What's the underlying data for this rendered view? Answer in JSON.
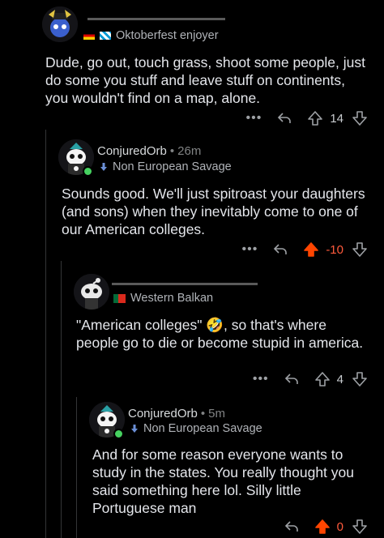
{
  "colors": {
    "background": "#000000",
    "text": "#e4e6eb",
    "muted": "#818384",
    "upvoted_orange": "#ff4500",
    "negative_score": "#ff5a3c",
    "online": "#46d160"
  },
  "comments": [
    {
      "username": "",
      "time": "",
      "flair": "Oktoberfest enjoyer",
      "flair_icons": [
        "germany-flag-icon",
        "bavaria-flag-icon"
      ],
      "body": "Dude, go out, touch grass, shoot some people, just do some you stuff and leave stuff on continents, you wouldn't find on a map, alone.",
      "score": "14",
      "voted": "none"
    },
    {
      "username": "ConjuredOrb",
      "time": "26m",
      "flair": "Non European Savage",
      "flair_icons": [
        "arrow-down-icon"
      ],
      "body": "Sounds good. We'll just spitroast your daughters (and sons) when they inevitably come to one of our American colleges.",
      "score": "-10",
      "voted": "up"
    },
    {
      "username": "",
      "time": "",
      "flair": "Western Balkan",
      "flair_icons": [
        "portugal-flag-icon"
      ],
      "body": "\"American colleges\" 🤣, so that's where people go to die or become stupid in america.",
      "score": "4",
      "voted": "none"
    },
    {
      "username": "ConjuredOrb",
      "time": "5m",
      "flair": "Non European Savage",
      "flair_icons": [
        "arrow-down-icon"
      ],
      "body": "And for some reason everyone wants to study in the states. You really thought you said something here lol. Silly little Portuguese man",
      "score": "0",
      "voted": "up"
    }
  ]
}
